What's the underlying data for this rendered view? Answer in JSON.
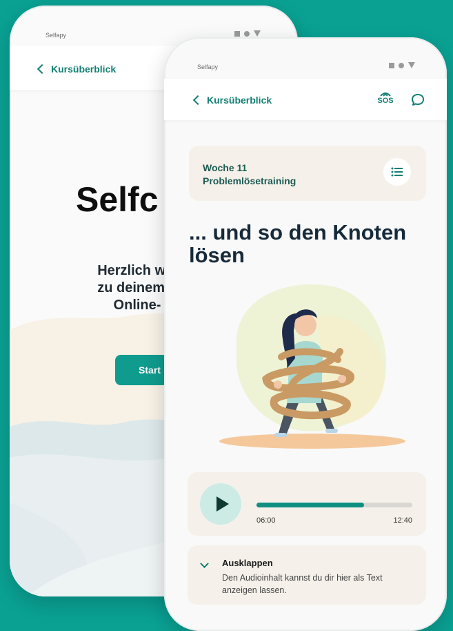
{
  "back_phone": {
    "status_brand": "Selfapy",
    "nav_back_label": "Kursüberblick",
    "title": "Selfc",
    "welcome_lines": [
      "Herzlich will",
      "zu deinem b",
      "Online-"
    ],
    "start_label": "Start"
  },
  "front_phone": {
    "status_brand": "Selfapy",
    "nav_back_label": "Kursüberblick",
    "sos_label": "SOS",
    "week": {
      "label": "Woche 11",
      "topic": "Problemlösetraining"
    },
    "headline": "... und so den Knoten lösen",
    "audio": {
      "current_time": "06:00",
      "total_time": "12:40",
      "progress_fraction": 0.69
    },
    "expand": {
      "title": "Ausklappen",
      "description": "Den Audioinhalt kannst du dir hier als Text anzeigen lassen."
    }
  },
  "colors": {
    "background": "#0aa193",
    "brand_teal": "#127f73",
    "card_beige": "#f5f1ea",
    "progress_fill": "#0f8f82"
  },
  "icons": [
    "chevron-left-icon",
    "sos-signal-icon",
    "chat-bubble-icon",
    "list-icon",
    "play-icon",
    "chevron-down-icon"
  ]
}
